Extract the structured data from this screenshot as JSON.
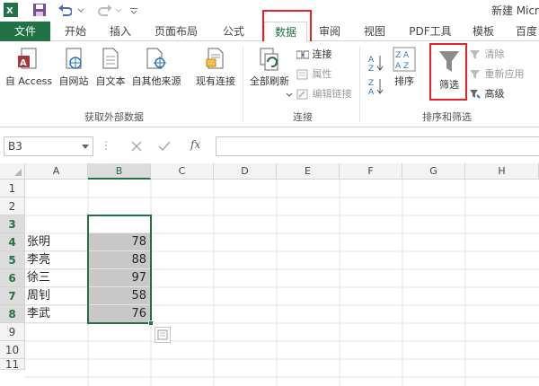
{
  "titlebar": {
    "title": "新建 Micr"
  },
  "tabs": [
    "文件",
    "开始",
    "插入",
    "页面布局",
    "公式",
    "数据",
    "审阅",
    "视图",
    "PDF工具",
    "模板",
    "百度"
  ],
  "ribbon": {
    "external": {
      "access": "自 Access",
      "web": "自网站",
      "text": "自文本",
      "other": "自其他来源",
      "existing": "现有连接",
      "group": "获取外部数据"
    },
    "connections": {
      "refresh": "全部刷新",
      "connect": "连接",
      "props": "属性",
      "edit": "编辑链接",
      "group": "连接"
    },
    "sortfilter": {
      "sort": "排序",
      "filter": "筛选",
      "clear": "清除",
      "reapply": "重新应用",
      "advanced": "高级",
      "group": "排序和筛选"
    }
  },
  "formula_bar": {
    "name_box": "B3",
    "fx": "fx",
    "value": ""
  },
  "columns": [
    "A",
    "B",
    "C",
    "D",
    "E",
    "F",
    "G",
    "H"
  ],
  "rows": [
    "1",
    "2",
    "3",
    "4",
    "5",
    "6",
    "7",
    "8",
    "9",
    "10",
    "11"
  ],
  "cells": {
    "names": [
      "张明",
      "李亮",
      "徐三",
      "周钊",
      "李武"
    ],
    "values": [
      "78",
      "88",
      "97",
      "58",
      "76"
    ]
  },
  "colors": {
    "accent": "#217346",
    "highlight": "#e8202b",
    "selection": "#c8c8c8"
  }
}
